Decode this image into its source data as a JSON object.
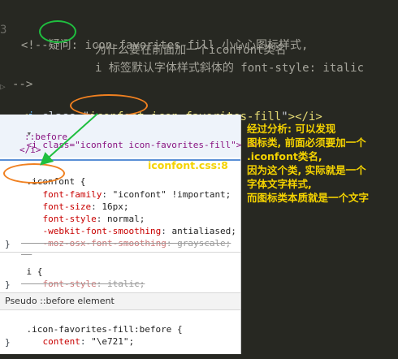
{
  "comment": {
    "open": "<!--",
    "question": "疑问:",
    "line1_rest": " icon-favorites-fill 小心心图标样式,",
    "line2": "为什么要在前面加一个iconfont类名",
    "line3": "i 标签默认字体样式斜体的 font-style: italic",
    "close": "-->",
    "left_fragment": "3"
  },
  "source_line": {
    "lt": "<",
    "tag": "i",
    "attr": "class",
    "eq_quote": "=\"",
    "val_highlight": "iconfont",
    "val_rest": " icon-favorites-fill",
    "close_quote": "\"",
    "end": "></i>"
  },
  "panel": {
    "element_row": "<i class=\"iconfont icon-favorites-fill\"> ==",
    "before_row": "::before",
    "close_row": "</i>",
    "rule1": {
      "selector": ".iconfont",
      "open": "{",
      "decls": [
        {
          "prop": "font-family",
          "value": "\"iconfont\" !important;"
        },
        {
          "prop": "font-size",
          "value": "16px;"
        },
        {
          "prop": "font-style",
          "value": "normal;"
        },
        {
          "prop": "-webkit-font-smoothing",
          "value": "antialiased;"
        },
        {
          "prop": "-moz-osx-font-smoothing",
          "value": "grayscale;"
        }
      ],
      "close": "}"
    },
    "rule2": {
      "selector": "i",
      "open": "{",
      "decl_prop": "font-style",
      "decl_value": "italic;",
      "close": "}"
    },
    "pseudo_header": "Pseudo ::before element",
    "rule3": {
      "selector": ".icon-favorites-fill:before",
      "open": "{",
      "decl_prop": "content",
      "decl_value": "\"\\e721\";",
      "close": "}"
    }
  },
  "annotation": {
    "file_ref": "iconfont.css:8",
    "lines": [
      "经过分析: 可以发现",
      "图标类, 前面必须要加一个",
      ".iconfont类名,",
      "因为这个类, 实际就是一个",
      "字体文字样式,",
      "而图标类本质就是一个文字"
    ]
  },
  "colors": {
    "editor_bg": "#272822",
    "annotation": "#f5d300",
    "green_highlight": "#1fbf3f",
    "orange_highlight": "#f08020"
  }
}
